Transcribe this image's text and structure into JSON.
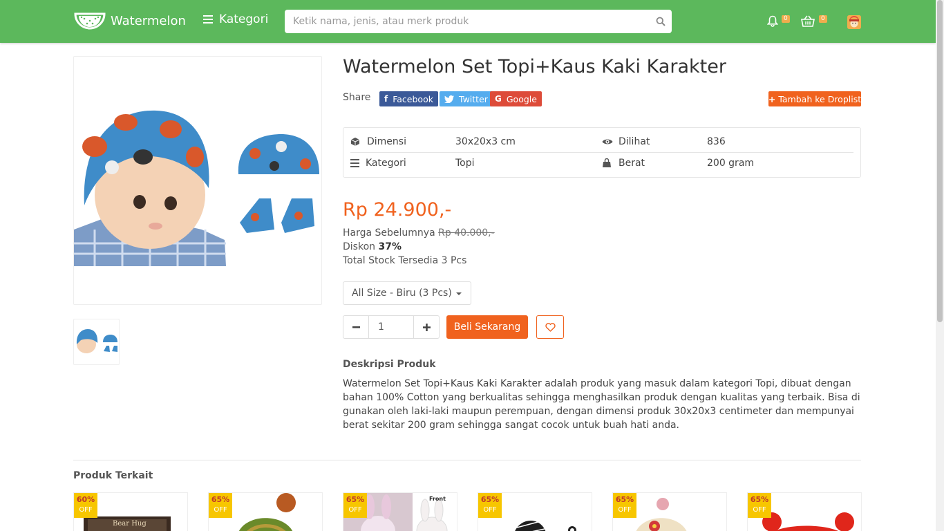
{
  "navbar": {
    "brand": "Watermelon",
    "category_label": "Kategori",
    "search_placeholder": "Ketik nama, jenis, atau merk produk",
    "notification_count": "0",
    "cart_count": "0",
    "colors": {
      "bar": "#5cb85c",
      "badge": "#f0ad4e"
    }
  },
  "product": {
    "title": "Watermelon Set Topi+Kaus Kaki Karakter",
    "share_label": "Share",
    "share_buttons": [
      "Facebook",
      "Twitter",
      "Google"
    ],
    "droplist_label": "Tambah ke Droplist",
    "specs": {
      "dimensi_label": "Dimensi",
      "dimensi_value": "30x20x3 cm",
      "dilihat_label": "Dilihat",
      "dilihat_value": "836",
      "kategori_label": "Kategori",
      "kategori_value": "Topi",
      "berat_label": "Berat",
      "berat_value": "200 gram"
    },
    "price": "Rp 24.900,-",
    "prev_price_label": "Harga Sebelumnya",
    "prev_price": "Rp 40.000,-",
    "discount_label": "Diskon",
    "discount_value": "37%",
    "stock_text": "Total Stock Tersedia 3 Pcs",
    "variant_selected": "All Size - Biru (3 Pcs)",
    "quantity": "1",
    "buy_label": "Beli Sekarang",
    "description_title": "Deskripsi Produk",
    "description": "Watermelon Set Topi+Kaus Kaki Karakter adalah produk yang masuk dalam kategori Topi, dibuat dengan bahan 100% Cotton yang berkualitas sehingga menghasilkan produk dengan kualitas yang terbaik. Bisa di gunakan oleh laki-laki maupun perempuan, dengan dimensi produk 30x20x3 centimeter dan mempunyai berat sekitar 200 gram sehingga sangat cocok untuk buah hati anda.",
    "accent_color": "#f0621e"
  },
  "related": {
    "title": "Produk Terkait",
    "items": [
      {
        "discount": "60%",
        "off": "OFF",
        "label": "Bear Hug"
      },
      {
        "discount": "65%",
        "off": "OFF"
      },
      {
        "discount": "65%",
        "off": "OFF",
        "label": "Front"
      },
      {
        "discount": "65%",
        "off": "OFF"
      },
      {
        "discount": "65%",
        "off": "OFF"
      },
      {
        "discount": "65%",
        "off": "OFF"
      }
    ]
  }
}
